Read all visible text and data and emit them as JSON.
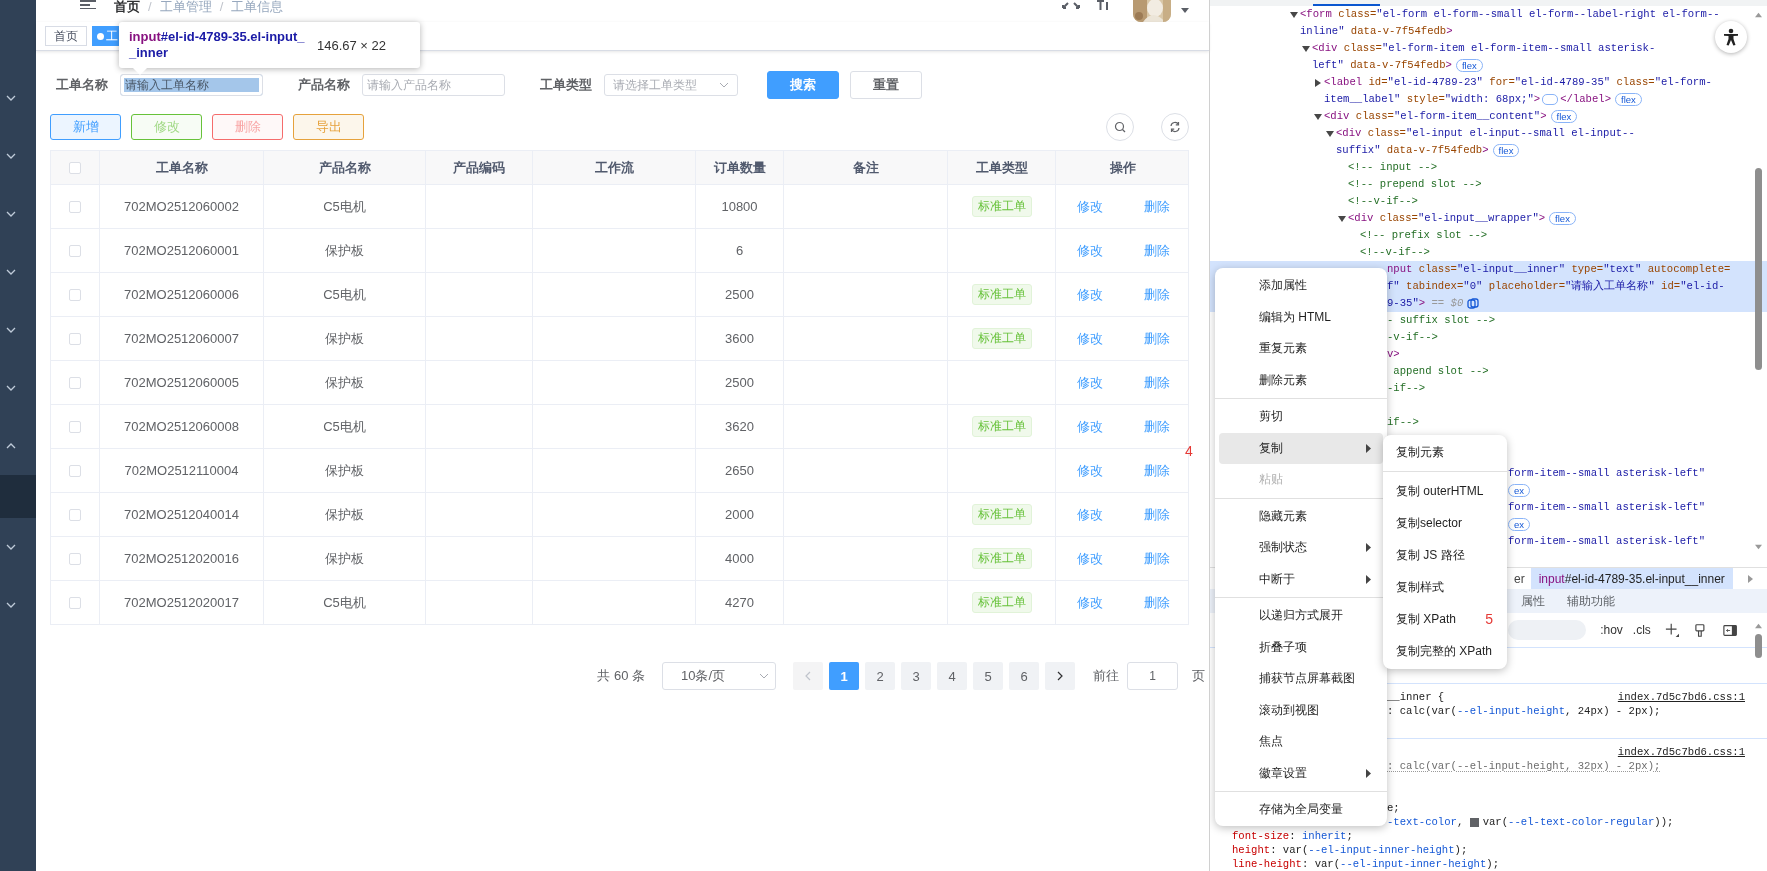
{
  "sidebar": {
    "items": [
      {
        "expanded": false
      },
      {
        "expanded": false
      },
      {
        "expanded": false
      },
      {
        "expanded": false
      },
      {
        "expanded": false
      },
      {
        "expanded": false
      },
      {
        "expanded": true,
        "children": [
          {
            "selected": true
          }
        ]
      },
      {
        "expanded": false
      },
      {
        "expanded": false
      }
    ]
  },
  "breadcrumb": [
    {
      "kind": "link",
      "text": "首页"
    },
    {
      "kind": "separator",
      "text": "/"
    },
    {
      "kind": "item",
      "text": "工单管理"
    },
    {
      "kind": "separator",
      "text": "/"
    },
    {
      "kind": "item",
      "text": "工单信息"
    }
  ],
  "tags": [
    {
      "label": "首页",
      "selected": false
    },
    {
      "label": "工",
      "selected": true
    }
  ],
  "tooltip": {
    "tag": "input",
    "selector": "#el-id-4789-35.el-input__inner",
    "size": "146.67 × 22"
  },
  "filters": [
    {
      "label": "工单名称",
      "kind": "input",
      "placeholder": "请输入工单名称",
      "selected": true
    },
    {
      "label": "产品名称",
      "kind": "input",
      "placeholder": "请输入产品名称",
      "selected": false
    },
    {
      "label": "工单类型",
      "kind": "select",
      "placeholder": "请选择工单类型",
      "selected": false
    }
  ],
  "search_button": "搜索",
  "reset_button": "重置",
  "actions": [
    {
      "label": "新增",
      "color": "#409eff",
      "disabled": false
    },
    {
      "label": "修改",
      "color": "#67c23a",
      "disabled": true
    },
    {
      "label": "删除",
      "color": "#f56c6c",
      "disabled": true
    },
    {
      "label": "导出",
      "color": "#e6a23c",
      "disabled": false
    }
  ],
  "table": {
    "header_checked": false,
    "columns": [
      "工单名称",
      "产品名称",
      "产品编码",
      "工作流",
      "订单数量",
      "备注",
      "工单类型",
      "操作"
    ],
    "rows": [
      {
        "checked": false,
        "name": "702MO2512060002",
        "product": "C5电机",
        "quantity": "10800",
        "type": "标准工单",
        "actions": [
          "修改",
          "删除"
        ]
      },
      {
        "checked": false,
        "name": "702MO2512060001",
        "product": "保护板",
        "quantity": "6",
        "actions": [
          "修改",
          "删除"
        ]
      },
      {
        "checked": false,
        "name": "702MO2512060006",
        "product": "C5电机",
        "quantity": "2500",
        "type": "标准工单",
        "actions": [
          "修改",
          "删除"
        ]
      },
      {
        "checked": false,
        "name": "702MO2512060007",
        "product": "保护板",
        "quantity": "3600",
        "type": "标准工单",
        "actions": [
          "修改",
          "删除"
        ]
      },
      {
        "checked": false,
        "name": "702MO2512060005",
        "product": "保护板",
        "quantity": "2500",
        "actions": [
          "修改",
          "删除"
        ]
      },
      {
        "checked": false,
        "name": "702MO2512060008",
        "product": "C5电机",
        "quantity": "3620",
        "type": "标准工单",
        "actions": [
          "修改",
          "删除"
        ]
      },
      {
        "checked": false,
        "name": "702MO2512110004",
        "product": "保护板",
        "quantity": "2650",
        "actions": [
          "修改",
          "删除"
        ]
      },
      {
        "checked": false,
        "name": "702MO2512040014",
        "product": "保护板",
        "quantity": "2000",
        "type": "标准工单",
        "actions": [
          "修改",
          "删除"
        ]
      },
      {
        "checked": false,
        "name": "702MO2512020016",
        "product": "保护板",
        "quantity": "4000",
        "type": "标准工单",
        "actions": [
          "修改",
          "删除"
        ]
      },
      {
        "checked": false,
        "name": "702MO2512020017",
        "product": "C5电机",
        "quantity": "4270",
        "type": "标准工单",
        "actions": [
          "修改",
          "删除"
        ]
      }
    ]
  },
  "marker": "4",
  "pagination": {
    "total": "共 60 条",
    "page_size": "10条/页",
    "prev": {
      "disabled": true
    },
    "next": {
      "disabled": false
    },
    "pages": [
      {
        "label": "1",
        "selected": true
      },
      {
        "label": "2",
        "selected": false
      },
      {
        "label": "3",
        "selected": false
      },
      {
        "label": "4",
        "selected": false
      },
      {
        "label": "5",
        "selected": false
      },
      {
        "label": "6",
        "selected": false
      }
    ],
    "goto_label": "前往",
    "goto_value": "1",
    "page_suffix": "页"
  },
  "devtools": {
    "tree": [
      {
        "expanded": true,
        "segments": [
          {
            "kind": "tag",
            "text": "<form"
          },
          {
            "kind": "attr",
            "text": " class="
          },
          {
            "kind": "value",
            "text": "\"el-form el-form--small el-form--label-right el-form--inline\""
          },
          {
            "kind": "attr",
            "text": " data-v-7f54fedb"
          },
          {
            "kind": "tag",
            "text": ">"
          }
        ],
        "children": [
          {
            "expanded": true,
            "badge": "flex",
            "segments": [
              {
                "kind": "tag",
                "text": "<div"
              },
              {
                "kind": "attr",
                "text": " class="
              },
              {
                "kind": "value",
                "text": "\"el-form-item el-form-item--small asterisk-left\""
              },
              {
                "kind": "attr",
                "text": " data-v-7f54fedb"
              },
              {
                "kind": "tag",
                "text": ">"
              }
            ],
            "children": [
              {
                "expanded": false,
                "badge": "flex",
                "segments": [
                  {
                    "kind": "tag",
                    "text": "<label"
                  },
                  {
                    "kind": "attr",
                    "text": " id="
                  },
                  {
                    "kind": "value",
                    "text": "\"el-id-4789-23\""
                  },
                  {
                    "kind": "attr",
                    "text": " for="
                  },
                  {
                    "kind": "value",
                    "text": "\"el-id-4789-35\""
                  },
                  {
                    "kind": "attr",
                    "text": " class="
                  },
                  {
                    "kind": "value",
                    "text": "\"el-form-item__label\""
                  },
                  {
                    "kind": "attr",
                    "text": " style="
                  },
                  {
                    "kind": "value",
                    "text": "\"width: 68px;\""
                  },
                  {
                    "kind": "tag",
                    "text": ">"
                  }
                ],
                "closing": [
                  {
                    "kind": "tag",
                    "text": "</label>"
                  }
                ]
              },
              {
                "expanded": true,
                "badge": "flex",
                "segments": [
                  {
                    "kind": "tag",
                    "text": "<div"
                  },
                  {
                    "kind": "attr",
                    "text": " class="
                  },
                  {
                    "kind": "value",
                    "text": "\"el-form-item__content\""
                  },
                  {
                    "kind": "tag",
                    "text": ">"
                  }
                ],
                "children": [
                  {
                    "expanded": true,
                    "badge": "flex",
                    "segments": [
                      {
                        "kind": "tag",
                        "text": "<div"
                      },
                      {
                        "kind": "attr",
                        "text": " class="
                      },
                      {
                        "kind": "value",
                        "text": "\"el-input el-input--small el-input--suffix\""
                      },
                      {
                        "kind": "attr",
                        "text": " data-v-7f54fedb"
                      },
                      {
                        "kind": "tag",
                        "text": ">"
                      }
                    ],
                    "children": [
                      {
                        "segments": [
                          {
                            "kind": "comment",
                            "text": "<!-- input -->"
                          }
                        ]
                      },
                      {
                        "segments": [
                          {
                            "kind": "comment",
                            "text": "<!-- prepend slot -->"
                          }
                        ]
                      },
                      {
                        "segments": [
                          {
                            "kind": "comment",
                            "text": "<!--v-if-->"
                          }
                        ]
                      },
                      {
                        "expanded": true,
                        "badge": "flex",
                        "segments": [
                          {
                            "kind": "tag",
                            "text": "<div"
                          },
                          {
                            "kind": "attr",
                            "text": " class="
                          },
                          {
                            "kind": "value",
                            "text": "\"el-input__wrapper\""
                          },
                          {
                            "kind": "tag",
                            "text": ">"
                          }
                        ],
                        "children": [
                          {
                            "segments": [
                              {
                                "kind": "comment",
                                "text": "<!-- prefix slot -->"
                              }
                            ]
                          },
                          {
                            "segments": [
                              {
                                "kind": "comment",
                                "text": "<!--v-if-->"
                              }
                            ]
                          }
                        ]
                      }
                    ]
                  }
                ]
              }
            ]
          }
        ]
      }
    ],
    "menu_side_lines": [
      {
        "kind": "code",
        "selected": true,
        "segments": [
          {
            "kind": "tag",
            "text": "nput"
          },
          {
            "kind": "attr",
            "text": " class="
          },
          {
            "kind": "value",
            "text": "\"el-input__inner\""
          },
          {
            "kind": "attr",
            "text": " type="
          },
          {
            "kind": "value",
            "text": "\"text\""
          },
          {
            "kind": "attr",
            "text": " autocomplete="
          }
        ]
      },
      {
        "kind": "code",
        "selected": true,
        "segments": [
          {
            "kind": "value",
            "text": "f\""
          },
          {
            "kind": "attr",
            "text": " tabindex="
          },
          {
            "kind": "value",
            "text": "\"0\""
          },
          {
            "kind": "attr",
            "text": " placeholder="
          },
          {
            "kind": "value",
            "text": "\"请输入工单名称\""
          },
          {
            "kind": "attr",
            "text": " id="
          },
          {
            "kind": "value",
            "text": "\"el-id-"
          }
        ]
      },
      {
        "kind": "code",
        "selected": true,
        "icon": true,
        "segments": [
          {
            "kind": "value",
            "text": "9-35\""
          },
          {
            "kind": "tag",
            "text": ">"
          },
          {
            "kind": "muted",
            "text": " == $0"
          }
        ]
      },
      {
        "kind": "code",
        "selected": false,
        "segments": [
          {
            "kind": "comment",
            "text": "- suffix slot -->"
          }
        ]
      },
      {
        "kind": "code",
        "selected": false,
        "segments": [
          {
            "kind": "comment",
            "text": "-v-if-->"
          }
        ]
      },
      {
        "kind": "code",
        "selected": false,
        "segments": [
          {
            "kind": "tag",
            "text": "v>"
          }
        ]
      },
      {
        "kind": "code",
        "selected": false,
        "segments": [
          {
            "kind": "comment",
            "text": " append slot -->"
          }
        ]
      },
      {
        "kind": "code",
        "selected": false,
        "segments": [
          {
            "kind": "comment",
            "text": "-if-->"
          }
        ]
      },
      {
        "kind": "blank"
      },
      {
        "kind": "code",
        "selected": false,
        "segments": [
          {
            "kind": "comment",
            "text": "if-->"
          }
        ]
      },
      {
        "kind": "blank"
      },
      {
        "kind": "blank"
      }
    ],
    "submenu_side_lines": [
      {
        "kind": "code",
        "selected": false,
        "segments": [
          {
            "kind": "value",
            "text": "form-item--small asterisk-left\""
          }
        ]
      },
      {
        "kind": "code",
        "selected": false,
        "badge": "ex"
      },
      {
        "kind": "code",
        "selected": false,
        "segments": [
          {
            "kind": "value",
            "text": "form-item--small asterisk-left\""
          }
        ]
      },
      {
        "kind": "code",
        "selected": false,
        "badge": "ex"
      },
      {
        "kind": "code",
        "selected": false,
        "segments": [
          {
            "kind": "value",
            "text": "form-item--small asterisk-left\""
          }
        ]
      },
      {
        "kind": "blank"
      }
    ],
    "crumbs": [
      {
        "text": "er",
        "selected": false
      },
      {
        "tag": "input",
        "text": "#el-id-4789-35.el-input__inner",
        "selected": true
      }
    ],
    "panel_tabs": [
      {
        "label": "属性",
        "selected": false
      },
      {
        "label": "辅助功能",
        "selected": false
      }
    ],
    "filter_tools": [
      ":hov",
      ".cls"
    ],
    "styles_menu_side": [
      {
        "kind": "separator"
      },
      {
        "kind": "rule",
        "segments": [
          {
            "kind": "plain",
            "text": "__inner {"
          }
        ],
        "source": "index.7d5c7bd6.css:1"
      },
      {
        "kind": "rule",
        "struck": false,
        "segments": [
          {
            "kind": "plain",
            "text": ": calc(var("
          },
          {
            "kind": "var",
            "text": "--el-input-height"
          },
          {
            "kind": "plain",
            "text": ", 24px) - 2px);"
          }
        ]
      },
      {
        "kind": "blank"
      },
      {
        "kind": "separator"
      },
      {
        "kind": "rule",
        "source": "index.7d5c7bd6.css:1"
      },
      {
        "kind": "rule",
        "struck": true,
        "segments": [
          {
            "kind": "plain",
            "text": ": calc(var("
          },
          {
            "kind": "var",
            "text": "--el-input-height"
          },
          {
            "kind": "plain",
            "text": ", 32px) - 2px);"
          }
        ]
      },
      {
        "kind": "blank"
      },
      {
        "kind": "blank"
      },
      {
        "kind": "rule",
        "segments": [
          {
            "kind": "plain",
            "text": "e;"
          }
        ]
      },
      {
        "kind": "rule",
        "segments": [
          {
            "kind": "var",
            "text": "-text-color"
          },
          {
            "kind": "plain",
            "text": ", "
          },
          {
            "kind": "swatch"
          },
          {
            "kind": "plain",
            "text": "var("
          },
          {
            "kind": "var",
            "text": "--el-text-color-regular"
          },
          {
            "kind": "plain",
            "text": "));"
          }
        ]
      }
    ],
    "styles_below_menu": [
      {
        "kind": "rule",
        "segments": [
          {
            "kind": "prop",
            "text": "font-size"
          },
          {
            "kind": "plain",
            "text": ": "
          },
          {
            "kind": "var",
            "text": "inherit"
          },
          {
            "kind": "plain",
            "text": ";"
          }
        ]
      },
      {
        "kind": "rule",
        "segments": [
          {
            "kind": "prop",
            "text": "height"
          },
          {
            "kind": "plain",
            "text": ": var("
          },
          {
            "kind": "var",
            "text": "--el-input-inner-height"
          },
          {
            "kind": "plain",
            "text": ");"
          }
        ]
      },
      {
        "kind": "rule",
        "segments": [
          {
            "kind": "prop",
            "text": "line-height"
          },
          {
            "kind": "plain",
            "text": ": var("
          },
          {
            "kind": "var",
            "text": "--el-input-inner-height"
          },
          {
            "kind": "plain",
            "text": ");"
          }
        ]
      }
    ],
    "menu": [
      {
        "kind": "item",
        "label": "添加属性",
        "selected": false,
        "disabled": false,
        "submenu": false
      },
      {
        "kind": "item",
        "label": "编辑为 HTML",
        "selected": false,
        "disabled": false,
        "submenu": false
      },
      {
        "kind": "item",
        "label": "重复元素",
        "selected": false,
        "disabled": false,
        "submenu": false
      },
      {
        "kind": "item",
        "label": "删除元素",
        "selected": false,
        "disabled": false,
        "submenu": false
      },
      {
        "kind": "separator"
      },
      {
        "kind": "item",
        "label": "剪切",
        "selected": false,
        "disabled": false,
        "submenu": false
      },
      {
        "kind": "item",
        "label": "复制",
        "selected": true,
        "disabled": false,
        "submenu": true
      },
      {
        "kind": "item",
        "label": "粘贴",
        "selected": false,
        "disabled": true,
        "submenu": false
      },
      {
        "kind": "separator"
      },
      {
        "kind": "item",
        "label": "隐藏元素",
        "selected": false,
        "disabled": false,
        "submenu": false
      },
      {
        "kind": "item",
        "label": "强制状态",
        "selected": false,
        "disabled": false,
        "submenu": true
      },
      {
        "kind": "item",
        "label": "中断于",
        "selected": false,
        "disabled": false,
        "submenu": true
      },
      {
        "kind": "separator"
      },
      {
        "kind": "item",
        "label": "以递归方式展开",
        "selected": false,
        "disabled": false,
        "submenu": false
      },
      {
        "kind": "item",
        "label": "折叠子项",
        "selected": false,
        "disabled": false,
        "submenu": false
      },
      {
        "kind": "item",
        "label": "捕获节点屏幕截图",
        "selected": false,
        "disabled": false,
        "submenu": false
      },
      {
        "kind": "item",
        "label": "滚动到视图",
        "selected": false,
        "disabled": false,
        "submenu": false
      },
      {
        "kind": "item",
        "label": "焦点",
        "selected": false,
        "disabled": false,
        "submenu": false
      },
      {
        "kind": "item",
        "label": "徽章设置",
        "selected": false,
        "disabled": false,
        "submenu": true
      },
      {
        "kind": "separator"
      },
      {
        "kind": "item",
        "label": "存储为全局变量",
        "selected": false,
        "disabled": false,
        "submenu": false
      }
    ],
    "submenu": [
      {
        "kind": "item",
        "label": "复制元素",
        "selected": false
      },
      {
        "kind": "separator"
      },
      {
        "kind": "item",
        "label": "复制 outerHTML",
        "selected": false
      },
      {
        "kind": "item",
        "label": "复制selector",
        "selected": false
      },
      {
        "kind": "item",
        "label": "复制 JS 路径",
        "selected": false
      },
      {
        "kind": "item",
        "label": "复制样式",
        "selected": false
      },
      {
        "kind": "item",
        "label": "复制 XPath",
        "selected": false,
        "marker": "5"
      },
      {
        "kind": "item",
        "label": "复制完整的 XPath",
        "selected": false
      }
    ]
  }
}
